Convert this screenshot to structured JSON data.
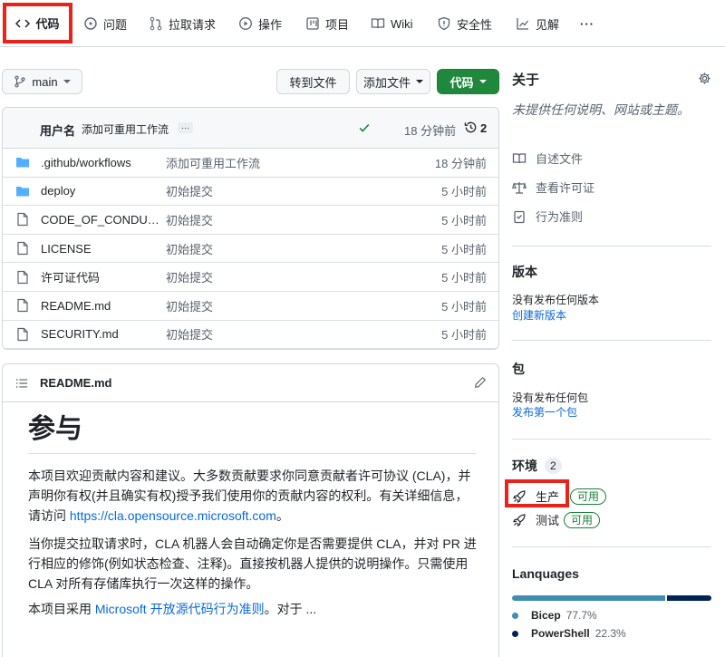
{
  "nav": {
    "tabs": [
      {
        "label": "代码",
        "icon": "code-icon"
      },
      {
        "label": "问题",
        "icon": "issue-icon"
      },
      {
        "label": "拉取请求",
        "icon": "pull-request-icon"
      },
      {
        "label": "操作",
        "icon": "play-icon"
      },
      {
        "label": "项目",
        "icon": "project-icon"
      },
      {
        "label": "Wiki",
        "icon": "book-icon"
      },
      {
        "label": "安全性",
        "icon": "shield-icon"
      },
      {
        "label": "见解",
        "icon": "graph-icon"
      },
      {
        "label": "···",
        "icon": "more-icon"
      }
    ]
  },
  "toolbar": {
    "branch": "main",
    "goto_file": "转到文件",
    "add_file": "添加文件",
    "code_button": "代码"
  },
  "commit": {
    "author": "用户名",
    "message": "添加可重用工作流",
    "ellipsis": "···",
    "time": "18 分钟前",
    "history_count": "2"
  },
  "files": [
    {
      "name": ".github/workflows",
      "type": "folder",
      "message": "添加可重用工作流",
      "time": "18 分钟前"
    },
    {
      "name": "deploy",
      "type": "folder",
      "message": "初始提交",
      "time": "5 小时前"
    },
    {
      "name": "CODE_OF_CONDUKT...",
      "type": "file",
      "message": "初始提交",
      "time": "5 小时前"
    },
    {
      "name": "LICENSE",
      "type": "file",
      "message": "初始提交",
      "time": "5 小时前"
    },
    {
      "name": "许可证代码",
      "type": "file",
      "message": "初始提交",
      "time": "5 小时前"
    },
    {
      "name": "README.md",
      "type": "file",
      "message": "初始提交",
      "time": "5 小时前"
    },
    {
      "name": "SECURITY.md",
      "type": "file",
      "message": "初始提交",
      "time": "5 小时前"
    }
  ],
  "readme": {
    "filename": "README.md",
    "heading": "参与",
    "p1_a": "本项目欢迎贡献内容和建议。大多数贡献要求你同意贡献者许可协议 (CLA)，并声明你有权(并且确实有权)授予我们使用你的贡献内容的权利。有关详细信息，请访问 ",
    "p1_link": "https://cla.opensource.microsoft.com",
    "p1_b": "。",
    "p2": "当你提交拉取请求时，CLA 机器人会自动确定你是否需要提供 CLA，并对 PR 进行相应的修饰(例如状态检查、注释)。直接按机器人提供的说明操作。只需使用 CLA 对所有存储库执行一次这样的操作。",
    "p3_a": "本项目采用 ",
    "p3_link": "Microsoft 开放源代码行为准则",
    "p3_b": "。对于 ..."
  },
  "about": {
    "title": "关于",
    "description": "未提供任何说明、网站或主题。",
    "links": [
      "自述文件",
      "查看许可证",
      "行为准则"
    ]
  },
  "releases": {
    "title": "版本",
    "empty": "没有发布任何版本",
    "create": "创建新版本"
  },
  "packages": {
    "title": "包",
    "empty": "没有发布任何包",
    "publish": "发布第一个包"
  },
  "environments": {
    "title": "环境",
    "count": "2",
    "items": [
      {
        "name": "生产",
        "status": "可用"
      },
      {
        "name": "测试",
        "status": "可用"
      }
    ]
  },
  "languages": {
    "title": "Lanquages",
    "items": [
      {
        "name": "Bicep",
        "percent": "77.7%",
        "value": 77.7,
        "color": "#3d8eb0"
      },
      {
        "name": "PowerShell",
        "percent": "22.3%",
        "value": 22.3,
        "color": "#012456"
      }
    ]
  }
}
